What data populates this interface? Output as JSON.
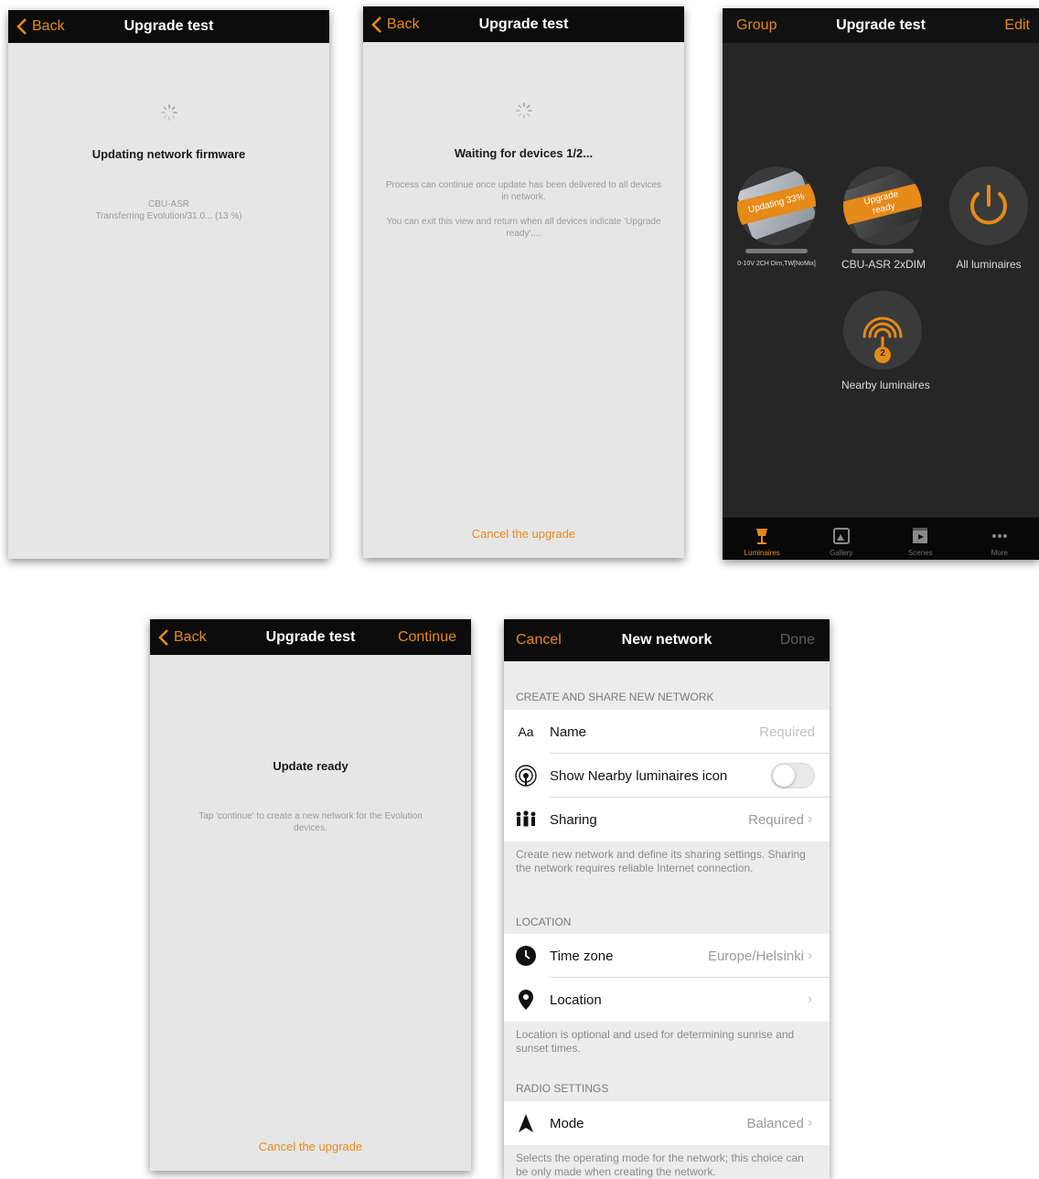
{
  "colors": {
    "accent": "#e68a1a",
    "navbar": "#0c0c0c",
    "screen_bg": "#e6e6e6",
    "dark_bg": "#262626"
  },
  "screen1": {
    "back": "Back",
    "title": "Upgrade test",
    "status": "Updating network firmware",
    "device": "CBU-ASR",
    "progress_text": "Transferring Evolution/31.0... (13 %)"
  },
  "screen2": {
    "back": "Back",
    "title": "Upgrade test",
    "status": "Waiting for devices 1/2...",
    "info1": "Process can continue once update has been delivered to all devices in network.",
    "info2": "You can exit this view and return when all devices indicate 'Upgrade ready'....",
    "cancel": "Cancel the upgrade"
  },
  "screen3": {
    "left": "Group",
    "title": "Upgrade test",
    "right": "Edit",
    "luminaires": [
      {
        "badge": "Updating 33%",
        "label": "0-10V 2CH Dim,TW[NoMix]"
      },
      {
        "badge": "Upgrade ready",
        "label": "CBU-ASR 2xDIM"
      },
      {
        "label": "All luminaires",
        "icon": "power-icon"
      }
    ],
    "nearby": {
      "label": "Nearby luminaires",
      "count": "2",
      "icon": "wifi-signal-icon"
    },
    "tabs": [
      {
        "label": "Luminaires",
        "icon": "lamp-icon",
        "active": true
      },
      {
        "label": "Gallery",
        "icon": "gallery-icon",
        "active": false
      },
      {
        "label": "Scenes",
        "icon": "scenes-icon",
        "active": false
      },
      {
        "label": "More",
        "icon": "more-icon",
        "active": false
      }
    ]
  },
  "screen4": {
    "back": "Back",
    "title": "Upgrade test",
    "right": "Continue",
    "status": "Update ready",
    "info": "Tap 'continue' to create a new network for the Evolution devices.",
    "cancel": "Cancel the upgrade"
  },
  "screen5": {
    "left": "Cancel",
    "title": "New network",
    "right": "Done",
    "section1": "CREATE AND SHARE NEW NETWORK",
    "name_icon": "Aa",
    "name_label": "Name",
    "name_placeholder": "Required",
    "nearby_label": "Show Nearby luminaires icon",
    "nearby_toggle_on": false,
    "sharing_label": "Sharing",
    "sharing_value": "Required",
    "section1_footer": "Create new network and define its sharing settings. Sharing the network requires reliable Internet connection.",
    "section2": "LOCATION",
    "timezone_label": "Time zone",
    "timezone_value": "Europe/Helsinki",
    "location_label": "Location",
    "section2_footer": "Location is optional and used for determining sunrise and sunset times.",
    "section3": "RADIO SETTINGS",
    "mode_label": "Mode",
    "mode_value": "Balanced",
    "section3_footer": "Selects the operating mode for the network; this choice can be only made when creating the network."
  }
}
